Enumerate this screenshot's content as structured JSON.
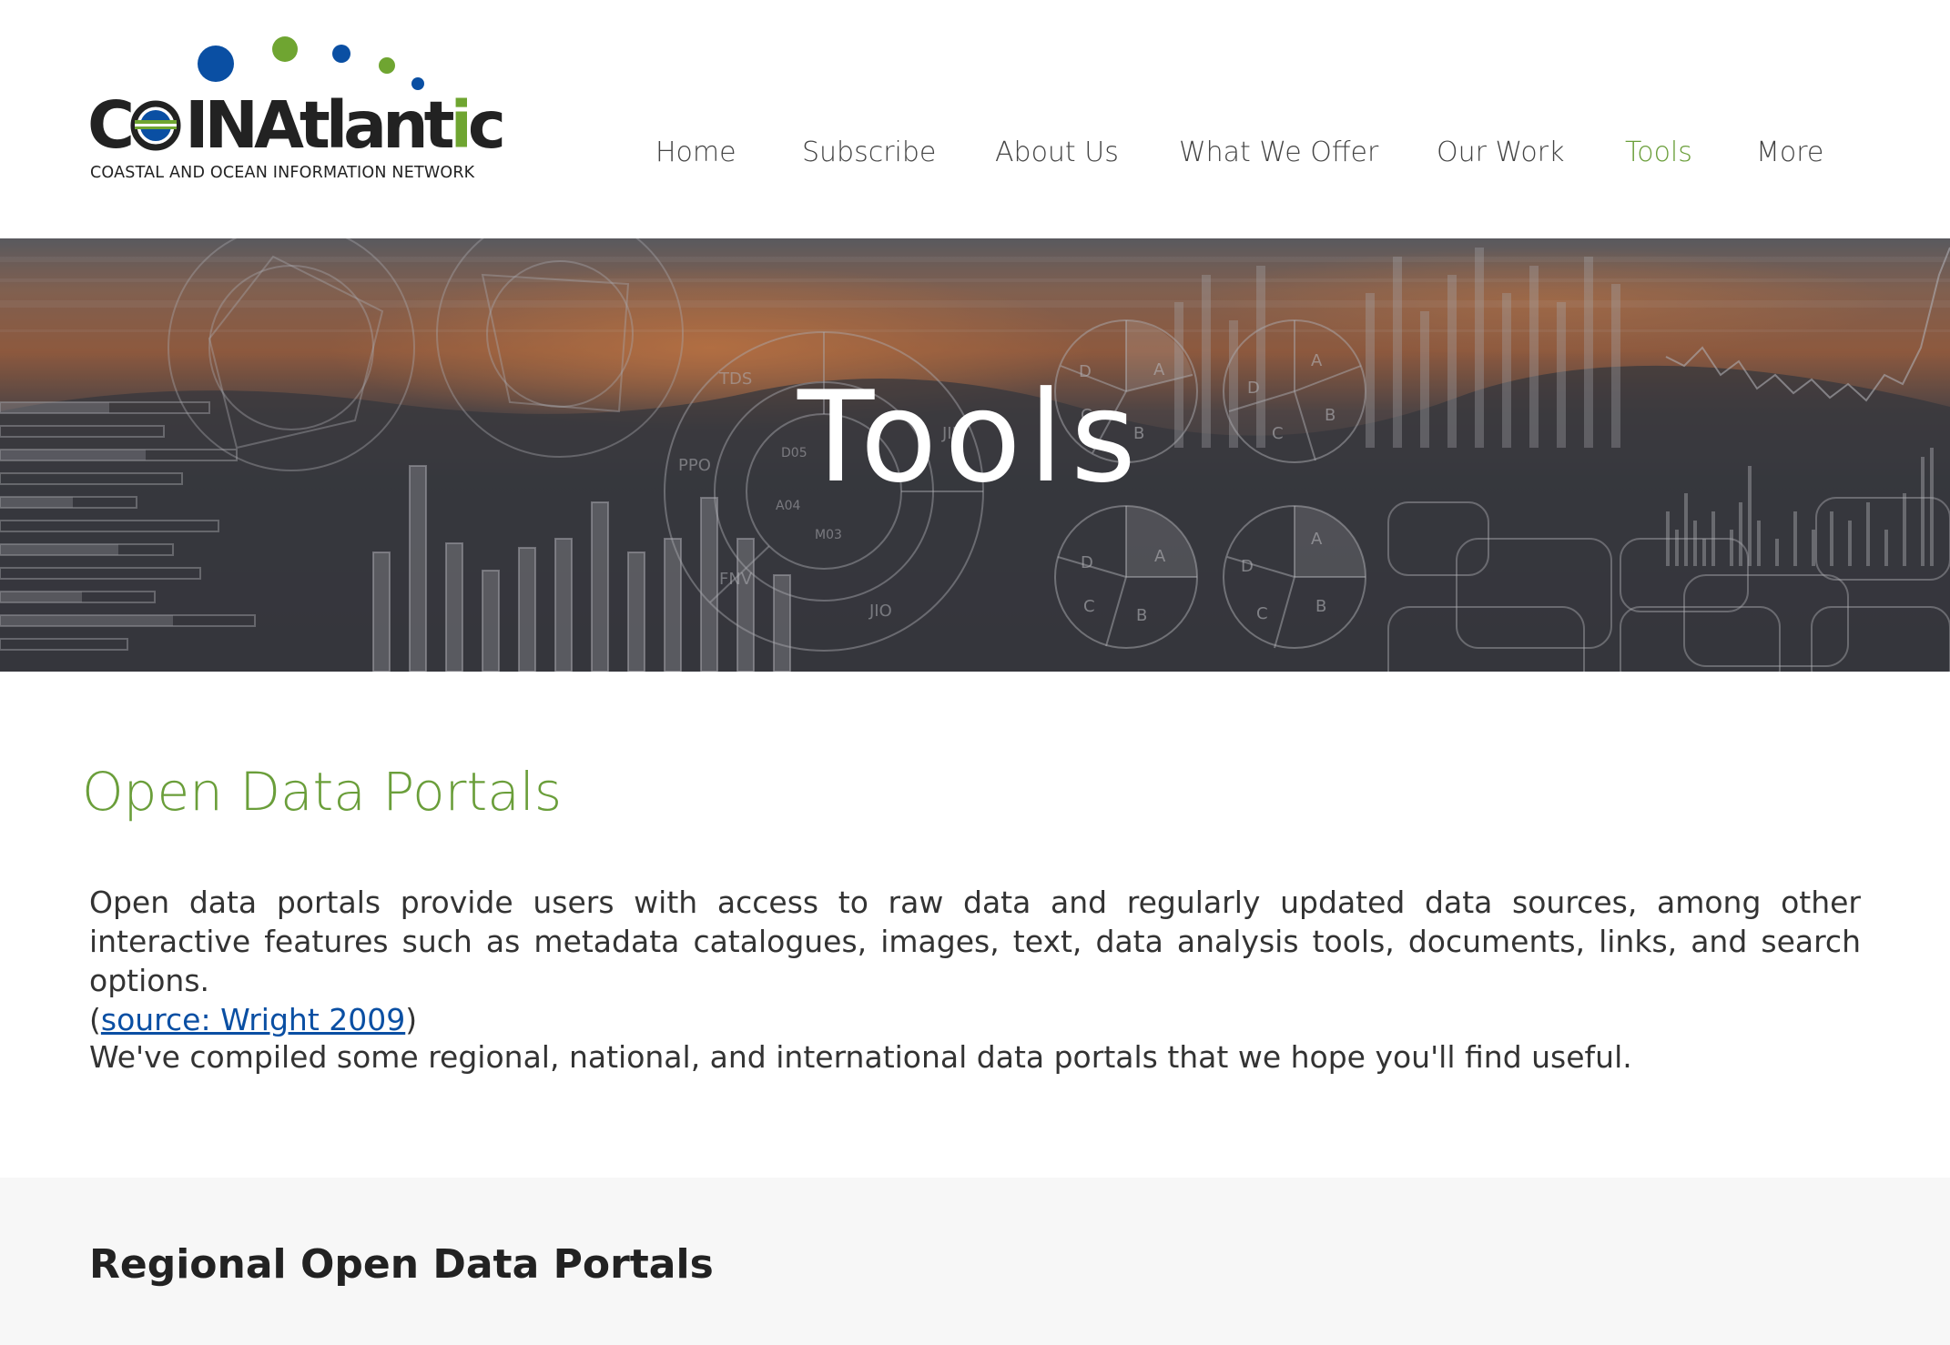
{
  "brand": {
    "name_part1": "C",
    "name_part2": "INAtlant",
    "name_part3": "i",
    "name_part4": "c",
    "tagline": "COASTAL AND OCEAN INFORMATION NETWORK",
    "colors": {
      "blue": "#0a4fa3",
      "green": "#6fa531",
      "dark": "#222222"
    }
  },
  "nav": {
    "items": [
      {
        "label": "Home",
        "active": false
      },
      {
        "label": "Subscribe",
        "active": false
      },
      {
        "label": "About Us",
        "active": false
      },
      {
        "label": "What We Offer",
        "active": false
      },
      {
        "label": "Our Work",
        "active": false
      },
      {
        "label": "Tools",
        "active": true
      },
      {
        "label": "More",
        "active": false
      }
    ],
    "active_color": "#6a9e3a"
  },
  "hero": {
    "title": "Tools",
    "background": "data dashboard graphics over sunset"
  },
  "main": {
    "section_title": "Open Data Portals",
    "intro_text": "Open data portals provide users with access to raw data and regularly updated data sources, among other interactive features such as metadata catalogues, images, text, data analysis tools, documents, links, and search options.",
    "source_open": "(",
    "source_link": "source: Wright 2009",
    "source_close": ")",
    "compiled_text": "We've compiled some regional, national, and international data portals that we hope you'll find useful.",
    "regional_title": "Regional Open Data Portals"
  }
}
